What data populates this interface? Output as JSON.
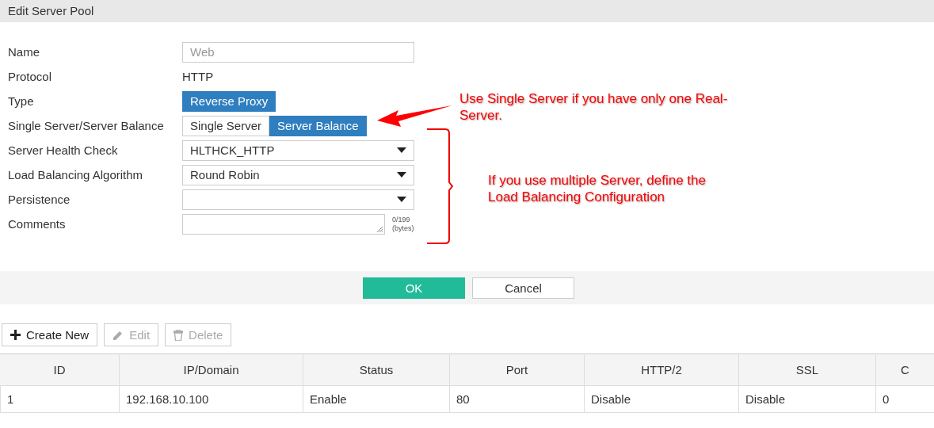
{
  "title": "Edit Server Pool",
  "fields": [
    {
      "label": "Name",
      "kind": "input",
      "value": "Web",
      "disabled": true
    },
    {
      "label": "Protocol",
      "kind": "text",
      "value": "HTTP"
    },
    {
      "label": "Type",
      "kind": "toggle",
      "options": [
        {
          "label": "Reverse Proxy",
          "selected": true
        }
      ]
    },
    {
      "label": "Single Server/Server Balance",
      "kind": "toggle",
      "options": [
        {
          "label": "Single Server",
          "selected": false
        },
        {
          "label": "Server Balance",
          "selected": true
        }
      ]
    },
    {
      "label": "Server Health Check",
      "kind": "select",
      "value": "HLTHCK_HTTP"
    },
    {
      "label": "Load Balancing Algorithm",
      "kind": "select",
      "value": "Round Robin"
    },
    {
      "label": "Persistence",
      "kind": "select"
    },
    {
      "label": "Comments",
      "kind": "textarea",
      "counter": "0/199",
      "counter_unit": "(bytes)"
    }
  ],
  "annotations": [
    {
      "kind": "arrow",
      "text": "Use Single Server if you have only one Real-\nServer."
    },
    {
      "kind": "bracket",
      "text": "If you use multiple Server, define the\nLoad Balancing Configuration"
    }
  ],
  "actions": [
    {
      "label": "OK",
      "kind": "primary"
    },
    {
      "label": "Cancel",
      "kind": "secondary"
    }
  ],
  "toolbar": [
    {
      "label": "Create New",
      "kind": "create",
      "disabled": false
    },
    {
      "label": "Edit",
      "kind": "edit",
      "disabled": true
    },
    {
      "label": "Delete",
      "kind": "delete",
      "disabled": true
    }
  ],
  "table": {
    "columns": [
      "ID",
      "IP/Domain",
      "Status",
      "Port",
      "HTTP/2",
      "SSL",
      "C"
    ],
    "rows": [
      [
        "1",
        "192.168.10.100",
        "Enable",
        "80",
        "Disable",
        "Disable",
        "0"
      ]
    ]
  }
}
